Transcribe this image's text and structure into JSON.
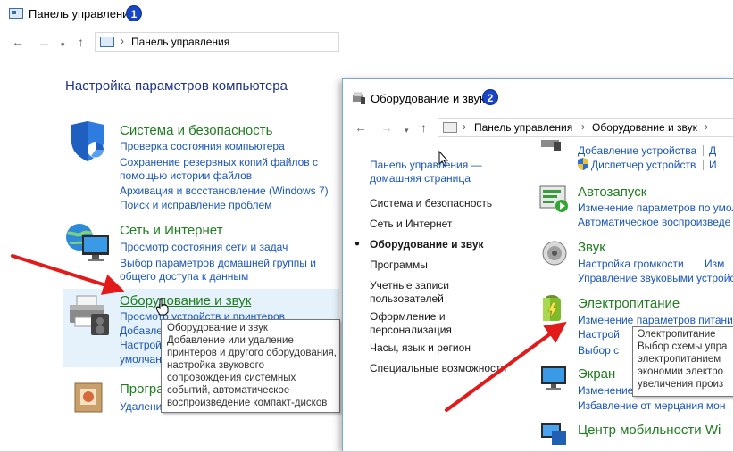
{
  "window1": {
    "title": "Панель управления",
    "badge": "1",
    "breadcrumb": [
      "Панель управления"
    ],
    "heading": "Настройка параметров компьютера",
    "categories": [
      {
        "title": "Система и безопасность",
        "links": [
          "Проверка состояния компьютера",
          "Сохранение резервных копий файлов с",
          "помощью истории файлов",
          "Архивация и восстановление (Windows 7)",
          "Поиск и исправление проблем"
        ]
      },
      {
        "title": "Сеть и Интернет",
        "links": [
          "Просмотр состояния сети и задач",
          "Выбор параметров домашней группы и",
          "общего доступа к данным"
        ]
      },
      {
        "title": "Оборудование и звук",
        "links": [
          "Просмотр устройств и принтеров",
          "Добавле",
          "Настрой",
          "умолчан"
        ]
      },
      {
        "title": "Програ",
        "links": [
          "Удалени"
        ]
      }
    ],
    "tooltip": [
      "Оборудование и звук",
      "Добавление или удаление",
      "принтеров и другого оборудования,",
      "настройка звукового",
      "сопровождения системных",
      "событий, автоматическое",
      "воспроизведение компакт-дисков"
    ]
  },
  "window2": {
    "title": "Оборудование и звук",
    "badge": "2",
    "breadcrumb": [
      "Панель управления",
      "Оборудование и звук"
    ],
    "left_nav": {
      "home_link_line1": "Панель управления —",
      "home_link_line2": "домашняя страница",
      "items": [
        "Система и безопасность",
        "Сеть и Интернет",
        "Оборудование и звук",
        "Программы",
        "Учетные записи",
        "пользователей",
        "Оформление и",
        "персонализация",
        "Часы, язык и регион",
        "Специальные возможности"
      ]
    },
    "sections": {
      "devices": {
        "link1": "Добавление устройства",
        "link2": "Диспетчер устройств",
        "cut1": "Д",
        "cut2": "И"
      },
      "autoplay": {
        "title": "Автозапуск",
        "link1": "Изменение параметров по умолча",
        "link2": "Автоматическое воспроизведе"
      },
      "sound": {
        "title": "Звук",
        "link1": "Настройка громкости",
        "link1b": "Изм",
        "link2": "Управление звуковыми устройств"
      },
      "power": {
        "title": "Электропитание",
        "link1": "Изменение параметров питани",
        "link2": "Настрой",
        "link3": "Выбор с"
      },
      "display": {
        "title": "Экран",
        "link1": "Изменение",
        "link2": "Избавление от мерцания мон"
      },
      "mobility": {
        "title": "Центр мобильности Wi"
      }
    },
    "tooltip": [
      "Электропитание",
      "Выбор схемы упра",
      "электропитанием",
      "экономии электро",
      "увеличения произ"
    ]
  },
  "colors": {
    "link": "#1a56b8",
    "category_title": "#1e7d1e",
    "heading": "#1e3287",
    "badge": "#1946c8",
    "arrow": "#e21a1a"
  },
  "icons": [
    "shield-icon",
    "network-icon",
    "printer-icon",
    "programs-icon",
    "autoplay-icon",
    "speaker-icon",
    "battery-icon",
    "monitor-icon",
    "mobility-icon",
    "cursor-hand-icon",
    "cursor-arrow-icon"
  ]
}
